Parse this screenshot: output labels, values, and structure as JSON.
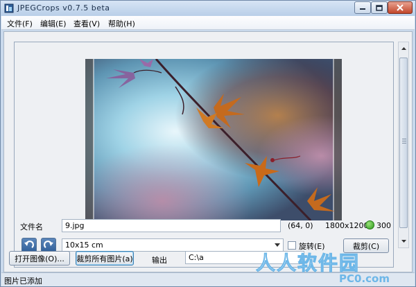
{
  "window": {
    "title": "JPEGCrops v0.7.5 beta",
    "icon": "jpegcrops-app-icon"
  },
  "menu": {
    "items": [
      "文件(F)",
      "编辑(E)",
      "查看(V)",
      "帮助(H)"
    ]
  },
  "file": {
    "label": "文件名",
    "name": "9.jpg",
    "offset": "(64, 0)",
    "dimensions": "1800x1200",
    "dpi": "300",
    "status_color": "#2d9a1c"
  },
  "crop": {
    "rotate_left_icon": "rotate-left-icon",
    "rotate_right_icon": "rotate-right-icon",
    "size_selected": "10x15 cm",
    "rotate_label": "旋转(E)",
    "rotate_checked": false,
    "crop_button": "裁剪(C)"
  },
  "actions": {
    "open_image": "打开图像(O)...",
    "crop_all": "裁剪所有图片(a)",
    "output_label": "输出",
    "output_path": "C:\\a"
  },
  "status": {
    "text": "图片已添加"
  },
  "watermark": {
    "text": "人人软件园",
    "domain": "PC0.com"
  },
  "colors": {
    "titlebar": "#c9d9ec",
    "accent": "#3c7fb1",
    "watermark": "#6db7e8"
  }
}
